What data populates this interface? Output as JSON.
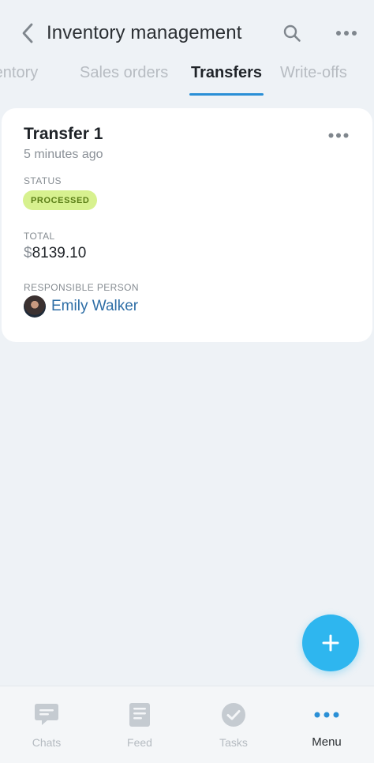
{
  "header": {
    "title": "Inventory management",
    "back_icon": "chevron-left-icon",
    "search_icon": "search-icon",
    "more_icon": "more-horizontal-icon"
  },
  "tabs": [
    {
      "label": "Inventory",
      "active": false
    },
    {
      "label": "Sales orders",
      "active": false
    },
    {
      "label": "Transfers",
      "active": true
    },
    {
      "label": "Write-offs",
      "active": false
    }
  ],
  "card": {
    "title": "Transfer 1",
    "time": "5 minutes ago",
    "status_label": "STATUS",
    "status_value": "PROCESSED",
    "total_label": "TOTAL",
    "total_currency": "$",
    "total_value": "8139.10",
    "person_label": "RESPONSIBLE PERSON",
    "person_name": "Emily Walker"
  },
  "fab": {
    "icon": "plus-icon"
  },
  "bottom_nav": [
    {
      "label": "Chats",
      "icon": "chat-icon",
      "active": false
    },
    {
      "label": "Feed",
      "icon": "feed-icon",
      "active": false
    },
    {
      "label": "Tasks",
      "icon": "check-circle-icon",
      "active": false
    },
    {
      "label": "Menu",
      "icon": "more-horizontal-icon",
      "active": true
    }
  ],
  "colors": {
    "accent": "#2a8fd6",
    "fab": "#2eb6ef",
    "badge_bg": "#d7f18f",
    "badge_text": "#5a7d16",
    "link": "#2e6ea6"
  }
}
